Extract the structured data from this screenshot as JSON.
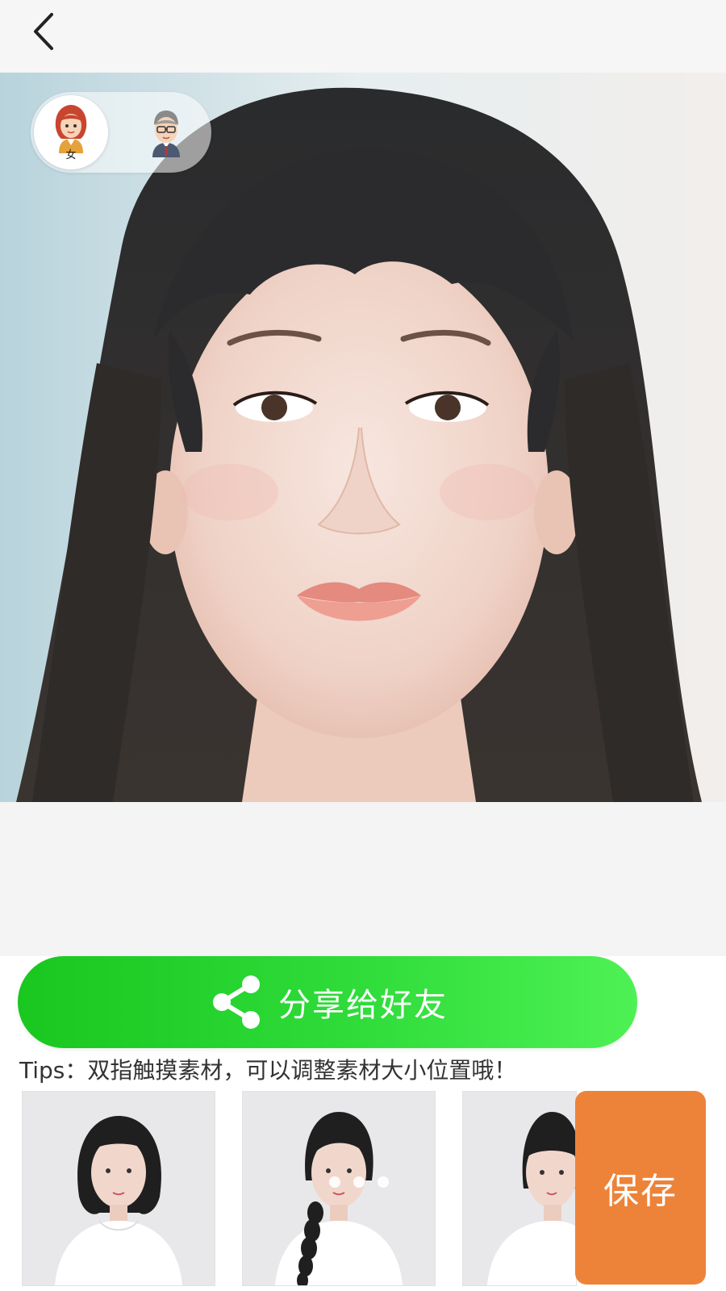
{
  "header": {
    "back_icon": "chevron-left-icon"
  },
  "gender_toggle": {
    "selected": "female",
    "female_label": "女",
    "female_icon": "female-avatar-icon",
    "male_icon": "male-avatar-icon"
  },
  "share": {
    "label": "分享给好友",
    "icon": "share-icon",
    "color_start": "#19c71f",
    "color_end": "#4ef154"
  },
  "tips": {
    "text": "Tips：双指触摸素材，可以调整素材大小位置哦！"
  },
  "templates": {
    "items": [
      {
        "name": "bob-haircut-template"
      },
      {
        "name": "braid-template"
      },
      {
        "name": "bangs-template"
      }
    ],
    "pager": {
      "count": 3
    }
  },
  "save": {
    "label": "保存",
    "color": "#ed8339"
  }
}
